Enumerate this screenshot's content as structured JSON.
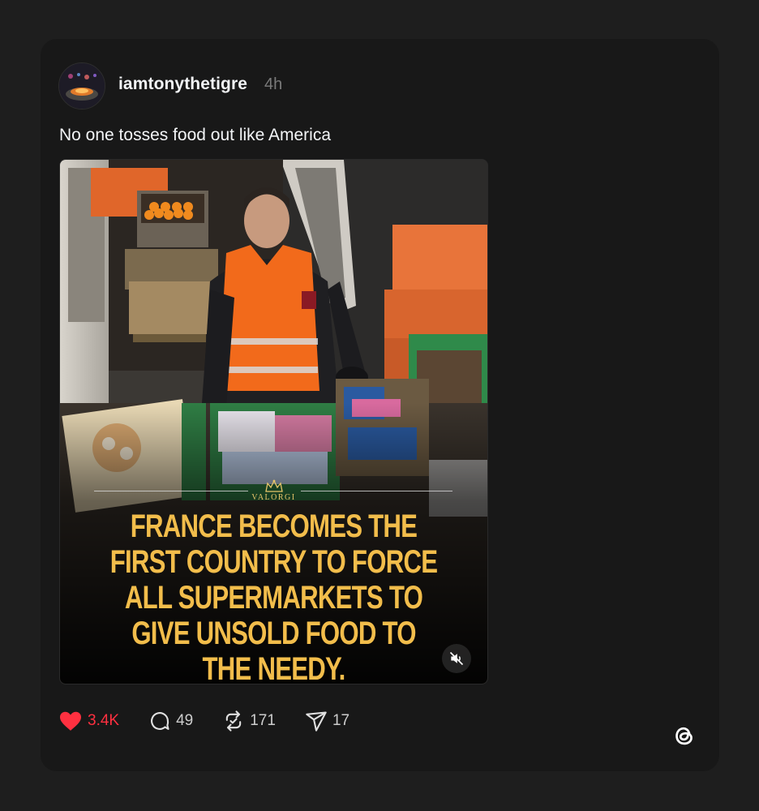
{
  "post": {
    "username": "iamtonythetigre",
    "timestamp": "4h",
    "text": "No one tosses food out like America",
    "avatar_icon": "avatar-image"
  },
  "media": {
    "brand": "VALORGI",
    "headline": "FRANCE BECOMES THE FIRST COUNTRY TO FORCE ALL SUPERMARKETS TO GIVE UNSOLD FOOD TO THE NEEDY.",
    "headline_color": "#f2bd4b",
    "mute_icon": "speaker-muted-icon"
  },
  "actions": {
    "likes": "3.4K",
    "replies": "49",
    "reposts": "171",
    "shares": "17",
    "like_color": "#ff3040"
  },
  "footer": {
    "logo_icon": "threads-logo-icon"
  }
}
